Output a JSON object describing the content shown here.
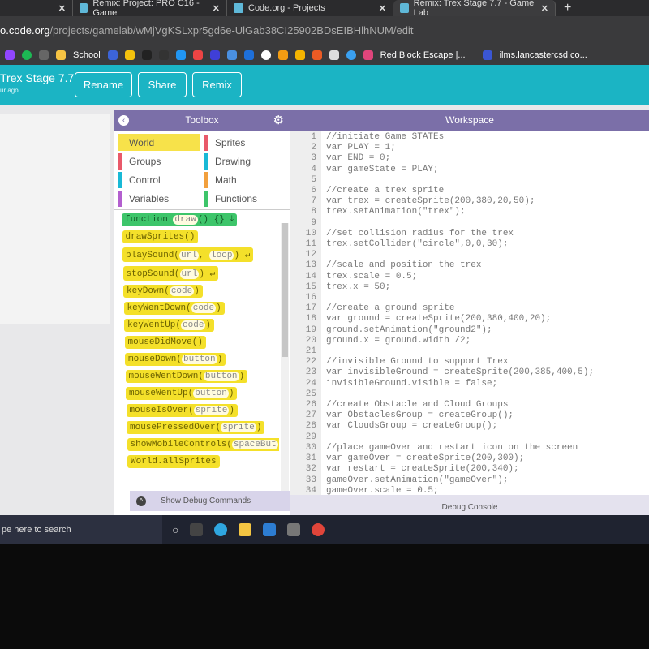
{
  "browser": {
    "tabs": [
      {
        "title": "Remix: Project: PRO C16 - Game"
      },
      {
        "title": "Code.org - Projects"
      },
      {
        "title": "Remix: Trex Stage 7.7 - Game Lab",
        "active": true
      }
    ],
    "url_host": "o.code.org",
    "url_path": "/projects/gamelab/wMjVgKSLxpr5gd6e-UlGab38CI25902BDsEIBHlhNUM/edit",
    "bookmarks": [
      {
        "label": "School"
      },
      {
        "label": "Red Block Escape |..."
      },
      {
        "label": "ilms.lancastercsd.co..."
      }
    ]
  },
  "header": {
    "title": "Trex Stage 7.7",
    "subtitle": "ur ago",
    "rename": "Rename",
    "share": "Share",
    "remix": "Remix",
    "color": "#1bb4c4"
  },
  "toolbox": {
    "title": "Toolbox",
    "categories": [
      {
        "label": "World",
        "color": "#f7e24a",
        "selected": true
      },
      {
        "label": "Sprites",
        "color": "#e9596a"
      },
      {
        "label": "Groups",
        "color": "#e9596a"
      },
      {
        "label": "Drawing",
        "color": "#19b9d6"
      },
      {
        "label": "Control",
        "color": "#19b9d6"
      },
      {
        "label": "Math",
        "color": "#f2a03d"
      },
      {
        "label": "Variables",
        "color": "#b35fcf"
      },
      {
        "label": "Functions",
        "color": "#3dc56a"
      }
    ],
    "blocks": [
      {
        "name": "function",
        "params": [
          "draw"
        ],
        "suffix": "() {} ⤓",
        "fn": true
      },
      {
        "name": "drawSprites()",
        "params": []
      },
      {
        "name": "playSound(",
        "params": [
          "url",
          "loop"
        ],
        "suffix": ") ↵"
      },
      {
        "name": "stopSound(",
        "params": [
          "url"
        ],
        "suffix": ") ↵"
      },
      {
        "name": "keyDown(",
        "params": [
          "code"
        ],
        "suffix": ")"
      },
      {
        "name": "keyWentDown(",
        "params": [
          "code"
        ],
        "suffix": ")"
      },
      {
        "name": "keyWentUp(",
        "params": [
          "code"
        ],
        "suffix": ")"
      },
      {
        "name": "mouseDidMove()",
        "params": []
      },
      {
        "name": "mouseDown(",
        "params": [
          "button"
        ],
        "suffix": ")"
      },
      {
        "name": "mouseWentDown(",
        "params": [
          "button"
        ],
        "suffix": ")"
      },
      {
        "name": "mouseWentUp(",
        "params": [
          "button"
        ],
        "suffix": ")"
      },
      {
        "name": "mouseIsOver(",
        "params": [
          "sprite"
        ],
        "suffix": ")"
      },
      {
        "name": "mousePressedOver(",
        "params": [
          "sprite"
        ],
        "suffix": ")"
      },
      {
        "name": "showMobileControls(",
        "params": [
          "spaceBut"
        ]
      },
      {
        "name": "World.allSprites",
        "params": []
      }
    ],
    "debug_label": "Show Debug Commands"
  },
  "workspace": {
    "title": "Workspace",
    "console_label": "Debug Console",
    "lines": [
      "//initiate Game STATEs",
      "var PLAY = 1;",
      "var END = 0;",
      "var gameState = PLAY;",
      "",
      "//create a trex sprite",
      "var trex = createSprite(200,380,20,50);",
      "trex.setAnimation(\"trex\");",
      "",
      "//set collision radius for the trex",
      "trex.setCollider(\"circle\",0,0,30);",
      "",
      "//scale and position the trex",
      "trex.scale = 0.5;",
      "trex.x = 50;",
      "",
      "//create a ground sprite",
      "var ground = createSprite(200,380,400,20);",
      "ground.setAnimation(\"ground2\");",
      "ground.x = ground.width /2;",
      "",
      "//invisible Ground to support Trex",
      "var invisibleGround = createSprite(200,385,400,5);",
      "invisibleGround.visible = false;",
      "",
      "//create Obstacle and Cloud Groups",
      "var ObstaclesGroup = createGroup();",
      "var CloudsGroup = createGroup();",
      "",
      "//place gameOver and restart icon on the screen",
      "var gameOver = createSprite(200,300);",
      "var restart = createSprite(200,340);",
      "gameOver.setAnimation(\"gameOver\");",
      "gameOver.scale = 0.5;"
    ]
  },
  "taskbar": {
    "search_placeholder": "pe here to search"
  }
}
